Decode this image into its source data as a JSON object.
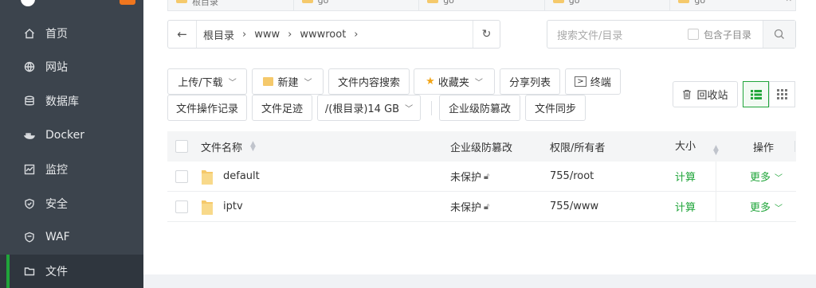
{
  "sidebar": {
    "items": [
      {
        "label": "首页",
        "icon": "home-icon"
      },
      {
        "label": "网站",
        "icon": "globe-icon"
      },
      {
        "label": "数据库",
        "icon": "database-icon"
      },
      {
        "label": "Docker",
        "icon": "docker-icon"
      },
      {
        "label": "监控",
        "icon": "monitor-icon"
      },
      {
        "label": "安全",
        "icon": "shield-icon"
      },
      {
        "label": "WAF",
        "icon": "waf-shield-icon"
      },
      {
        "label": "文件",
        "icon": "folder-icon"
      }
    ],
    "active_index": 7
  },
  "tabs": [
    {
      "label": "根目录"
    },
    {
      "label": "go"
    },
    {
      "label": "go"
    },
    {
      "label": "go"
    },
    {
      "label": "go"
    }
  ],
  "address": {
    "crumbs": [
      "根目录",
      "www",
      "wwwroot"
    ]
  },
  "search": {
    "placeholder": "搜索文件/目录",
    "include_subdir_label": "包含子目录"
  },
  "toolbar": {
    "upload_download": "上传/下载",
    "new": "新建",
    "content_search": "文件内容搜索",
    "favorites": "收藏夹",
    "share_list": "分享列表",
    "terminal": "终端",
    "operation_log": "文件操作记录",
    "footprint": "文件足迹",
    "disk_usage": "/(根目录)14 GB",
    "tamper_protect": "企业级防篡改",
    "file_sync": "文件同步",
    "recycle_bin": "回收站"
  },
  "table": {
    "headers": {
      "name": "文件名称",
      "protect": "企业级防篡改",
      "perm": "权限/所有者",
      "size": "大小",
      "ops": "操作"
    },
    "rows": [
      {
        "name": "default",
        "protect": "未保护",
        "perm": "755/root",
        "size": "计算",
        "ops": "更多"
      },
      {
        "name": "iptv",
        "protect": "未保护",
        "perm": "755/www",
        "size": "计算",
        "ops": "更多"
      }
    ]
  },
  "colors": {
    "accent": "#20a53a",
    "sidebar_bg": "#3c444d",
    "folder": "#f5c96b"
  }
}
